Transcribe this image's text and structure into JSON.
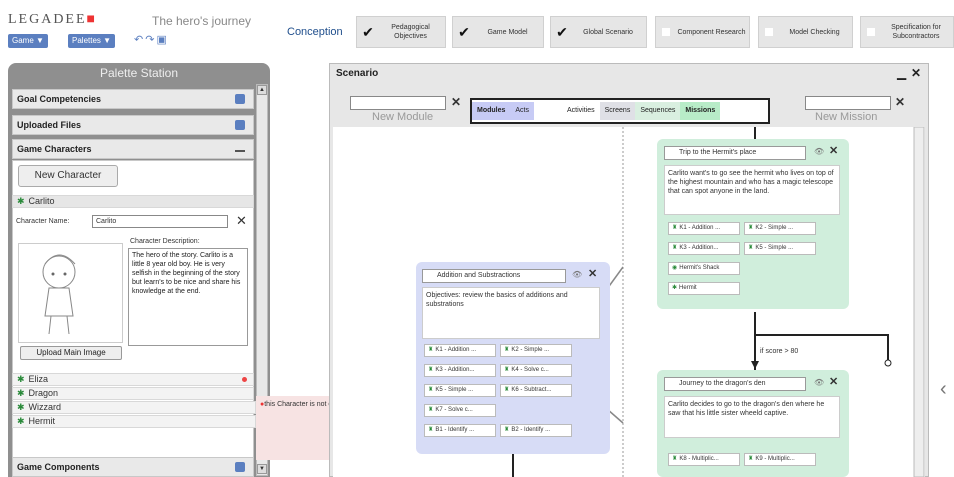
{
  "header": {
    "logo": "LEGADEE",
    "title": "The hero's journey",
    "game_btn": "Game ▼",
    "palettes_btn": "Palettes ▼",
    "conception": "Conception",
    "steps": [
      {
        "label": "Pedagogical Objectives",
        "checked": true
      },
      {
        "label": "Game Model",
        "checked": true
      },
      {
        "label": "Global Scenario",
        "checked": true
      },
      {
        "label": "Component Research",
        "checked": false
      },
      {
        "label": "Model Checking",
        "checked": false
      },
      {
        "label": "Specification for Subcontractors",
        "checked": false
      }
    ]
  },
  "palette": {
    "title": "Palette Station",
    "goal": "Goal Competencies",
    "uploaded": "Uploaded Files",
    "game_characters": "Game Characters",
    "new_character": "New Character",
    "selected": "Carlito",
    "name_label": "Character Name:",
    "name_value": "Carlito",
    "desc_label": "Character Description:",
    "desc_text": "The hero of the story. Carlito is a little 8 year old boy. He is very selfish in the beginning of the story but learn's to be nice and share his knowledge at the end.",
    "upload_btn": "Upload Main Image",
    "characters": [
      "Eliza",
      "Dragon",
      "Wizzard",
      "Hermit"
    ],
    "tooltip": "this Character is not connected to any item.",
    "game_components": "Game Components"
  },
  "scenario": {
    "title": "Scenario",
    "new_module": "New Module",
    "new_mission": "New Mission",
    "tabs": [
      "Modules",
      "Acts",
      "Activities",
      "Screens",
      "Sequences",
      "Missions"
    ],
    "modules_tab_color": "#c7cbf5",
    "missions_tab_color": "#b8ecc8",
    "module_card": {
      "title": "Addition and Substractions",
      "body": "Objectives: review the basics of additions and substrations",
      "pills": [
        "K1 - Addition ...",
        "K2 - Simple ...",
        "K3 - Addition...",
        "K4 - Solve c...",
        "K5 - Simple ...",
        "K6 - Subtract...",
        "K7 - Solve c...",
        "",
        "B1 - Identify ...",
        "B2 - Identify ..."
      ]
    },
    "mission1": {
      "title": "Trip to the Hermit's place",
      "body": "Carlito want's to go see the hermit who lives on top of the highest mountain and who has a magic telescope that can spot anyone in the land.",
      "pills": [
        "K1 - Addition ...",
        "K2 - Simple ...",
        "K3 - Addition...",
        "K5 - Simple ..."
      ],
      "items": [
        "Hermit's Shack",
        "Hermit"
      ]
    },
    "condition": "if score > 80",
    "mission2": {
      "title": "Journey to the dragon's den",
      "body": "Carlito decides to go to the dragon's den where he saw that his little sister wheeld captive.",
      "pills": [
        "K8 - Multiplic...",
        "K9 - Multiplic..."
      ]
    }
  }
}
